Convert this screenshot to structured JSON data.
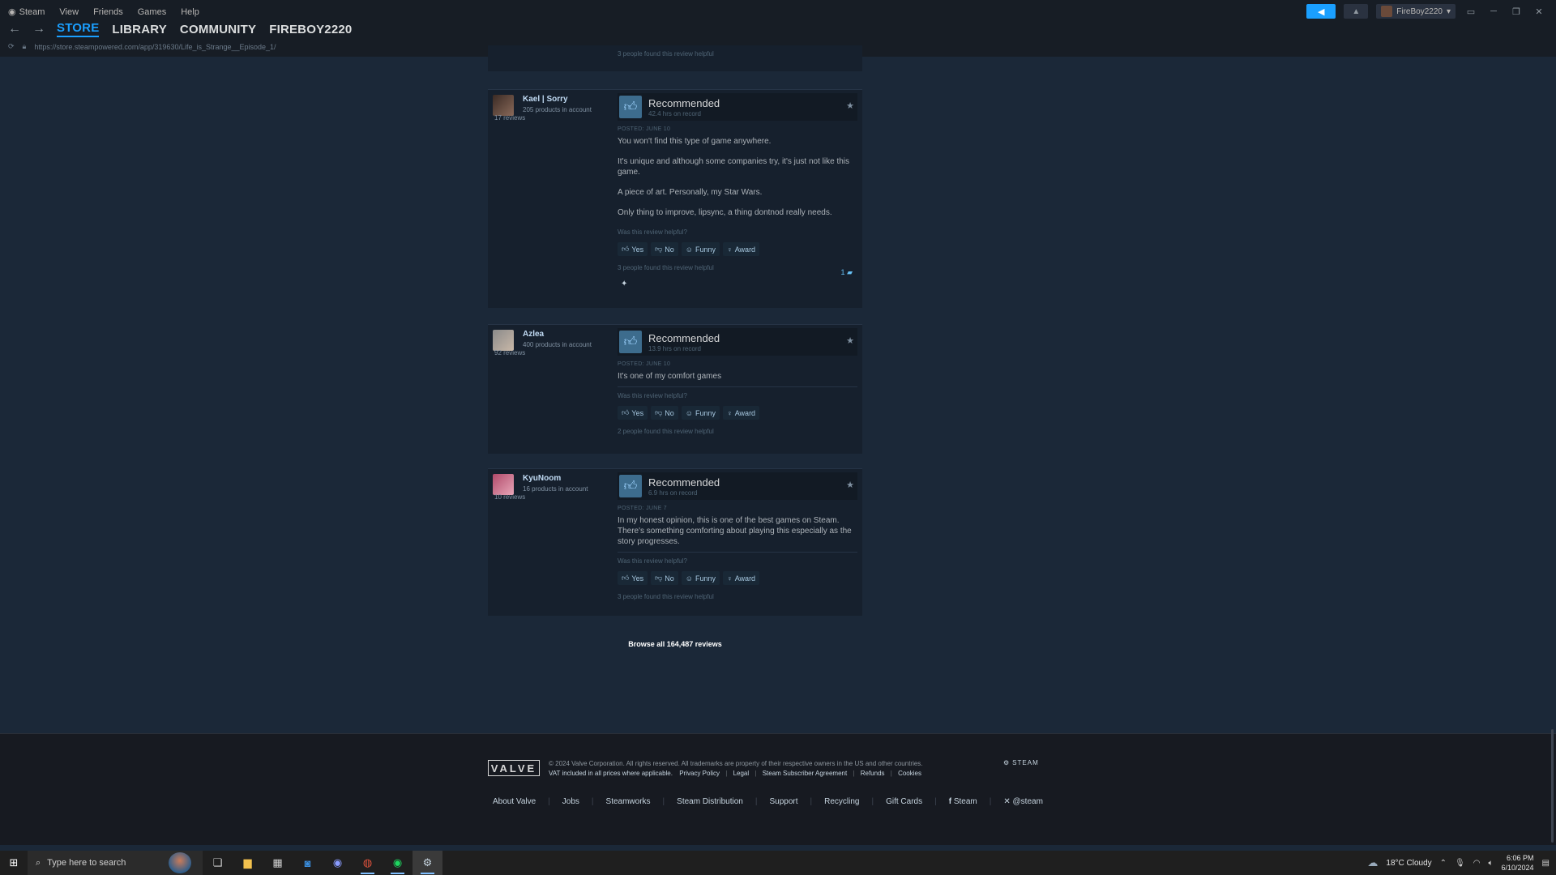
{
  "window": {
    "menu": [
      "Steam",
      "View",
      "Friends",
      "Games",
      "Help"
    ],
    "tabs": [
      "STORE",
      "LIBRARY",
      "COMMUNITY",
      "FIREBOY2220"
    ],
    "active_tab": "STORE",
    "url": "https://store.steampowered.com/app/319630/Life_is_Strange__Episode_1/",
    "username": "FireBoy2220"
  },
  "prev_review_footer": "3 people found this review helpful",
  "reviews": [
    {
      "author": "Kael | Sorry",
      "products": "205 products in account",
      "review_count": "17 reviews",
      "verdict": "Recommended",
      "hours": "42.4 hrs on record",
      "posted": "POSTED: JUNE 10",
      "paragraphs": [
        "You won't find this type of game anywhere.",
        "It's unique and although some companies try, it's just not like this game.",
        "A piece of art. Personally, my Star Wars.",
        "Only thing to improve, lipsync, a thing dontnod really needs."
      ],
      "helpful_q": "Was this review helpful?",
      "votes": [
        "Yes",
        "No",
        "Funny",
        "Award"
      ],
      "found": "3 people found this review helpful",
      "comments": "1"
    },
    {
      "author": "Azlea",
      "products": "400 products in account",
      "review_count": "92 reviews",
      "verdict": "Recommended",
      "hours": "13.9 hrs on record",
      "posted": "POSTED: JUNE 10",
      "paragraphs": [
        "It's one of my comfort games"
      ],
      "helpful_q": "Was this review helpful?",
      "votes": [
        "Yes",
        "No",
        "Funny",
        "Award"
      ],
      "found": "2 people found this review helpful"
    },
    {
      "author": "KyuNoom",
      "products": "16 products in account",
      "review_count": "10 reviews",
      "verdict": "Recommended",
      "hours": "6.9 hrs on record",
      "posted": "POSTED: JUNE 7",
      "paragraphs": [
        "In my honest opinion, this is one of the best games on Steam. There's something comforting about playing this especially as the story progresses."
      ],
      "helpful_q": "Was this review helpful?",
      "votes": [
        "Yes",
        "No",
        "Funny",
        "Award"
      ],
      "found": "3 people found this review helpful"
    }
  ],
  "browse_all": "Browse all 164,487 reviews",
  "footer": {
    "valve": "VALVE",
    "copyright": "© 2024 Valve Corporation. All rights reserved. All trademarks are property of their respective owners in the US and other countries.",
    "vat": "VAT included in all prices where applicable.",
    "legal_links": [
      "Privacy Policy",
      "Legal",
      "Steam Subscriber Agreement",
      "Refunds",
      "Cookies"
    ],
    "steam_logo": "STEAM",
    "links": [
      "About Valve",
      "Jobs",
      "Steamworks",
      "Steam Distribution",
      "Support",
      "Recycling",
      "Gift Cards",
      "Steam",
      "@steam"
    ]
  },
  "taskbar": {
    "search_placeholder": "Type here to search",
    "weather": "18°C  Cloudy",
    "time": "6:06 PM",
    "date": "6/10/2024"
  }
}
